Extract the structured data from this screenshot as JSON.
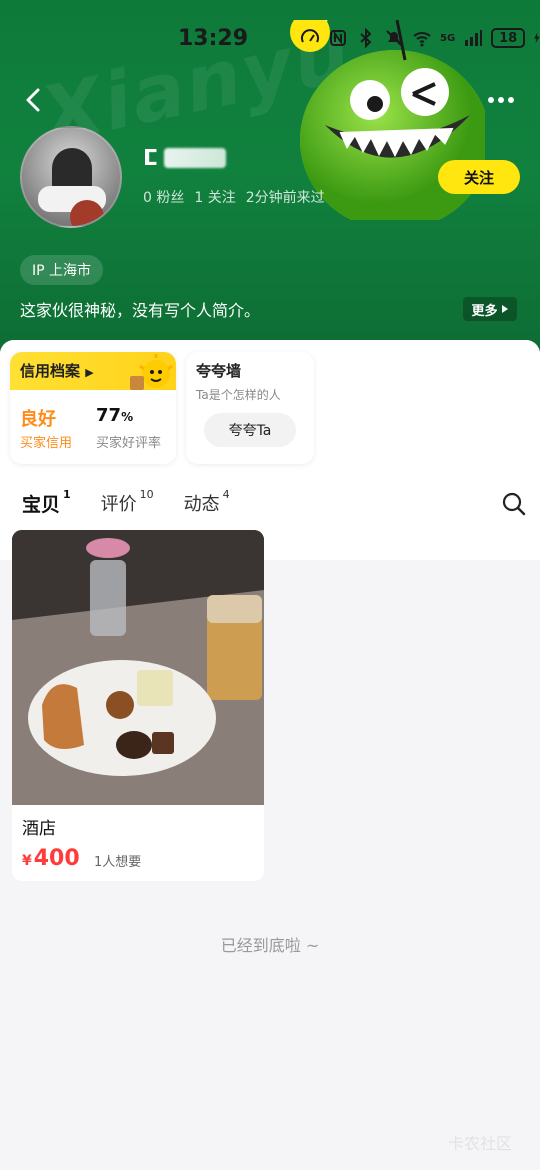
{
  "status_bar": {
    "time": "13:29",
    "battery": "18",
    "network": "5G",
    "icons": [
      "speed-icon",
      "nfc-icon",
      "bluetooth-icon",
      "mute-icon",
      "wifi-icon",
      "signal-icon",
      "charging-icon"
    ]
  },
  "profile": {
    "name_glyph": "ⵎ",
    "stats": [
      "0 粉丝",
      "1 关注",
      "2分钟前来过"
    ],
    "follow_label": "关注",
    "ip_label": "IP 上海市",
    "bio": "这家伙很神秘，没有写个人简介。",
    "more_label": "更多"
  },
  "credit": {
    "title": "信用档案",
    "rating": "良好",
    "rating_label": "买家信用",
    "rate_value": "77",
    "rate_unit": "%",
    "rate_label": "买家好评率"
  },
  "praise": {
    "title": "夸夸墙",
    "subtitle": "Ta是个怎样的人",
    "button": "夸夸Ta"
  },
  "tabs": [
    {
      "label": "宝贝",
      "count": "1",
      "active": true
    },
    {
      "label": "评价",
      "count": "10",
      "active": false
    },
    {
      "label": "动态",
      "count": "4",
      "active": false
    }
  ],
  "products": [
    {
      "title": "酒店",
      "currency": "¥",
      "price": "400",
      "wants": "1人想要"
    }
  ],
  "end_text": "已经到底啦 ~",
  "corner_mark": "卡农社区",
  "colors": {
    "header_green": "#11813e",
    "accent_yellow": "#ffe60f",
    "price_red": "#ff3b3b",
    "credit_orange": "#ff8c1a"
  }
}
